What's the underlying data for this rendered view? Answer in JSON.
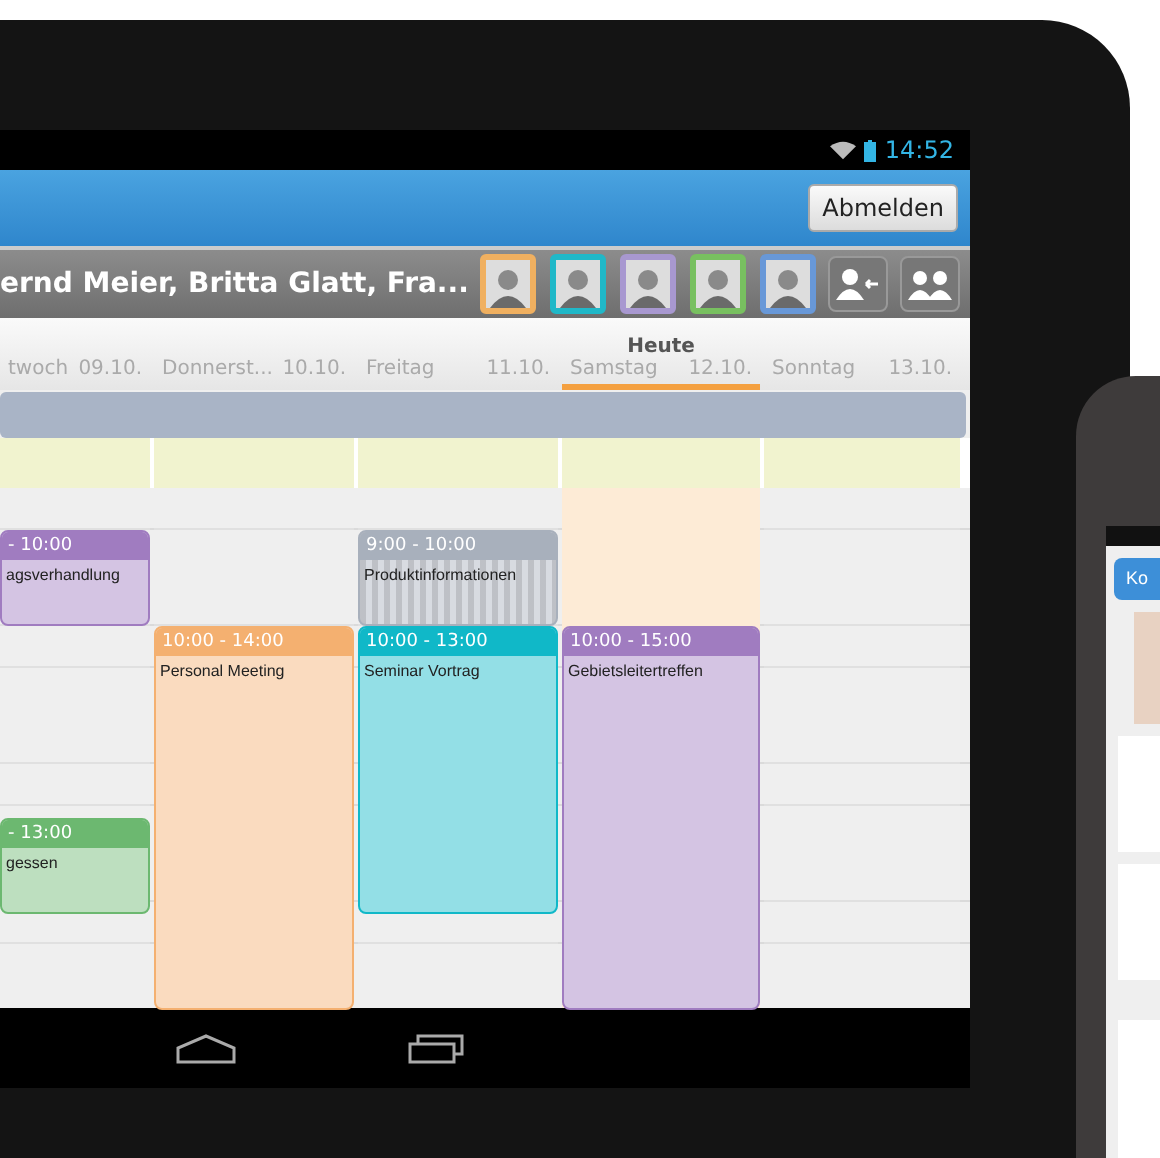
{
  "status_bar": {
    "time": "14:52"
  },
  "action_bar": {
    "logout_button": "Abmelden"
  },
  "toolbar": {
    "participants": "ernd Meier, Britta Glatt, Fra...",
    "avatars": [
      {
        "color": "#f0b060"
      },
      {
        "color": "#20b8c8"
      },
      {
        "color": "#a898d0"
      },
      {
        "color": "#78c060"
      },
      {
        "color": "#6898d8"
      }
    ]
  },
  "days": [
    {
      "weekday": "twoch",
      "date": "09.10.",
      "today": false,
      "events": [
        {
          "time": "- 10:00",
          "title": "agsverhandlung",
          "color": "#a07cc0",
          "striped": false
        },
        {
          "time": "- 13:00",
          "title": "gessen",
          "color": "#6cb870",
          "striped": false
        }
      ]
    },
    {
      "weekday": "Donnerst...",
      "date": "10.10.",
      "today": false,
      "events": [
        {
          "time": "10:00 - 14:00",
          "title": "Personal Meeting",
          "color": "#f4b070",
          "striped": false
        }
      ]
    },
    {
      "weekday": "Freitag",
      "date": "11.10.",
      "today": false,
      "events": [
        {
          "time": "9:00 - 10:00",
          "title": "Produktinformationen",
          "color": "#a8b0bc",
          "striped": true
        },
        {
          "time": "10:00 - 13:00",
          "title": "Seminar Vortrag",
          "color": "#10b8c8",
          "striped": false
        }
      ]
    },
    {
      "weekday": "Samstag",
      "date": "12.10.",
      "today": true,
      "today_label": "Heute",
      "events": [
        {
          "time": "10:00 - 15:00",
          "title": "Gebietsleitertreffen",
          "color": "#a07cc0",
          "striped": false
        }
      ]
    },
    {
      "weekday": "Sonntag",
      "date": "13.10.",
      "today": false
    }
  ],
  "phone": {
    "button": "Ko"
  }
}
